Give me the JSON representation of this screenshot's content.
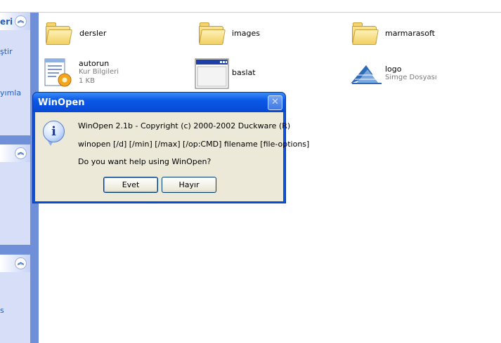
{
  "task_pane": {
    "panel1": {
      "title": "eri",
      "links": [
        "ştir",
        "yımla"
      ]
    },
    "panel3": {
      "links": [
        "s"
      ]
    }
  },
  "files": [
    {
      "name": "dersler",
      "icon": "folder-icon"
    },
    {
      "name": "images",
      "icon": "folder-icon"
    },
    {
      "name": "marmarasoft",
      "icon": "folder-icon"
    },
    {
      "name": "autorun",
      "sub1": "Kur Bilgileri",
      "sub2": "1 KB",
      "icon": "setup-info-icon"
    },
    {
      "name": "baslat",
      "icon": "application-window-icon"
    },
    {
      "name": "logo",
      "sub1": "Simge Dosyası",
      "icon": "logo-image-icon"
    }
  ],
  "dialog": {
    "title": "WinOpen",
    "line1": "WinOpen 2.1b - Copyright (c) 2000-2002 Duckware (R)",
    "line2": "winopen [/d] [/min] [/max] [/op:CMD] filename [file-options]",
    "line3": "Do you want help using WinOpen?",
    "yes_label": "Evet",
    "no_label": "Hayır",
    "close_glyph": "✕",
    "info_glyph": "i"
  },
  "colors": {
    "titlebar": "#0a58e6",
    "dialog_body": "#ece9d8",
    "task_pane": "#6f8fd8",
    "link": "#215dc6"
  }
}
